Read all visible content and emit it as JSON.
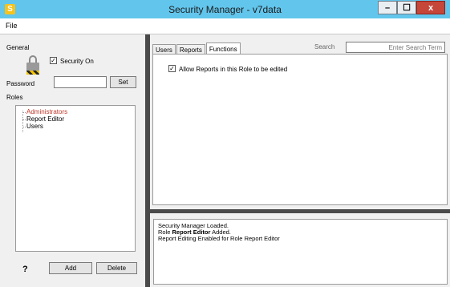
{
  "window": {
    "title": "Security Manager - v7data",
    "app_icon": "S",
    "minimize": "–",
    "maximize": "☐",
    "close": "x"
  },
  "menu": {
    "file": "File"
  },
  "left_panel": {
    "general_label": "General",
    "security_checkbox": {
      "label": "Security On",
      "checked": true
    },
    "password_label": "Password",
    "password_value": "",
    "set_button": "Set",
    "roles_label": "Roles",
    "roles": [
      {
        "label": "Administrators",
        "color": "#c0392b"
      },
      {
        "label": "Report Editor",
        "color": "#000000"
      },
      {
        "label": "Users",
        "color": "#000000"
      }
    ],
    "help_label": "?",
    "add_button": "Add",
    "delete_button": "Delete"
  },
  "right_panel": {
    "tabs": [
      {
        "label": "Users",
        "active": false
      },
      {
        "label": "Reports",
        "active": false
      },
      {
        "label": "Functions",
        "active": true
      }
    ],
    "search_label": "Search",
    "search_placeholder": "Enter Search Term",
    "functions_checkbox": {
      "label": "Allow Reports in this Role to be edited",
      "checked": true
    },
    "log_lines": [
      {
        "prefix": " Security Manager Loaded.",
        "bold": "",
        "suffix": ""
      },
      {
        "prefix": "Role ",
        "bold": "Report Editor",
        "suffix": " Added."
      },
      {
        "prefix": "Report Editing Enabled for Role Report Editor",
        "bold": "",
        "suffix": ""
      }
    ]
  }
}
